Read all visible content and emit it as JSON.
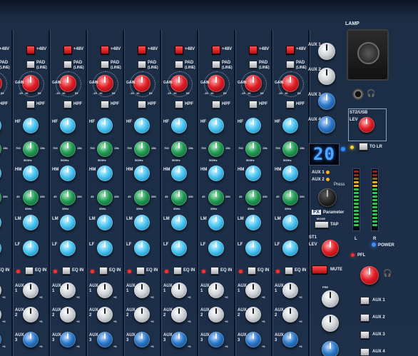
{
  "strip_labels": {
    "phantom": "+48V",
    "pad": "PAD",
    "pad_sub": "(LINE)",
    "gain": "GAIN",
    "gain_scale_left": "-10",
    "gain_scale_mid": "10",
    "gain_scale_right": "60",
    "hpf": "HPF",
    "hf": "HF",
    "hm": "HM",
    "lm": "LM",
    "lf": "LF",
    "freq_hi_left": "700",
    "freq_hi_right": "15k",
    "freq_hi_low": "500Hz",
    "freq_lm_left": "45",
    "freq_lm_right": "250",
    "freq_lm_low": "35Hz",
    "eq_in": "EQ IN",
    "aux1": "AUX 1",
    "aux2": "AUX 2",
    "aux3": "AUX 3",
    "plus6": "+6"
  },
  "master": {
    "lamp": "LAMP",
    "aux_labels": [
      "AUX 1",
      "AUX 2",
      "AUX 3",
      "AUX 4"
    ],
    "st2usb": "ST2/USB",
    "lev": "LEV",
    "to_lr": "TO LR",
    "display_value": "20",
    "fx_aux1": "AUX 1",
    "fx_aux2": "AUX 2",
    "press": "Press",
    "fx": "FX",
    "parameter": "Parameter",
    "mode": "MODE",
    "tap": "TAP",
    "st1": "ST1",
    "lev2": "LEV",
    "mute": "MUTE",
    "pfl": "PFL",
    "meter_l": "L",
    "meter_r": "R",
    "power": "POWER",
    "pre": "PRE",
    "aux_sends": [
      "AUX 1",
      "AUX 2",
      "AUX 3",
      "AUX 4"
    ]
  },
  "colors": {
    "panel": "#1d2f49",
    "knob_red": "#e01c24",
    "knob_cyan": "#49c4f1",
    "knob_green": "#1f9a53",
    "knob_blue": "#2a78c8",
    "display": "#4ea6ff"
  }
}
